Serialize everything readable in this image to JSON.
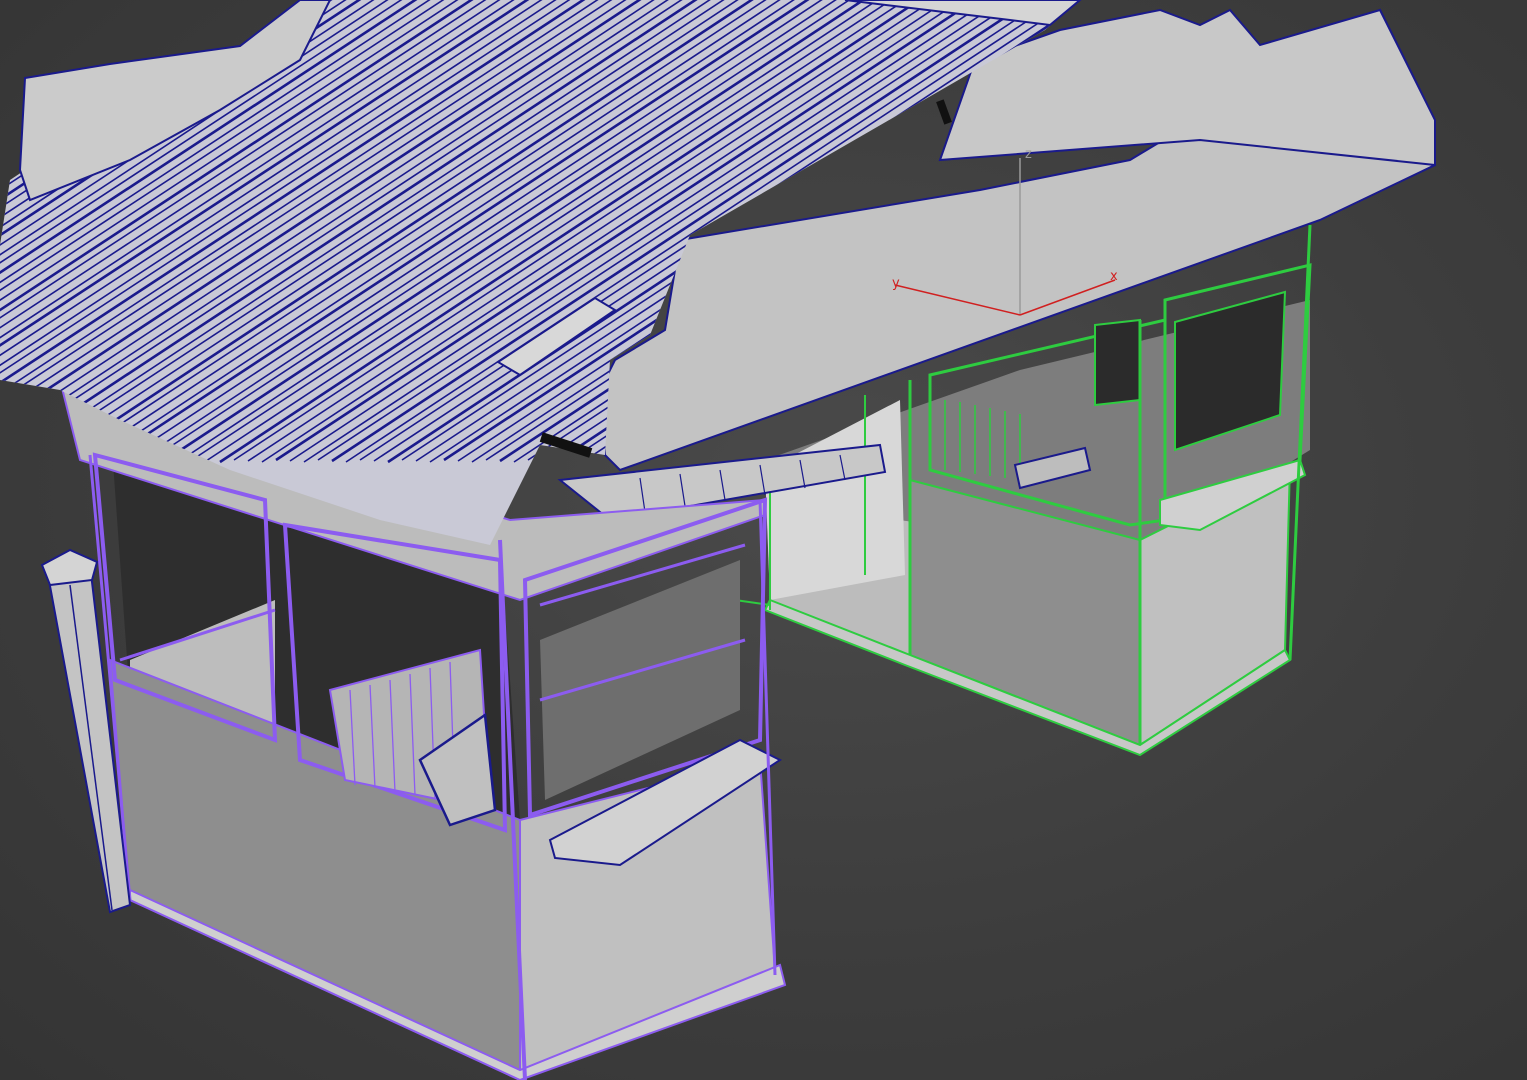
{
  "viewport": {
    "background": "#3d3d3d",
    "colors": {
      "shaded_surface": "#b4b4b4",
      "shaded_light": "#c8c8c8",
      "shaded_dark": "#8e8e8e",
      "roof_wire": "#1a1a8c",
      "booth_left_wire": "#8c5cf0",
      "booth_right_wire": "#2ecc40",
      "axis_x": "#d02020",
      "axis_y": "#d02020",
      "axis_z": "#9a9a9a"
    }
  },
  "gizmo": {
    "x_label": "x",
    "y_label": "y",
    "z_label": "z"
  },
  "objects": {
    "roof": "corrugated-roof",
    "left_booth": "guard-booth-left-selected",
    "right_booth": "guard-booth-right-selected",
    "post": "gate-post"
  }
}
